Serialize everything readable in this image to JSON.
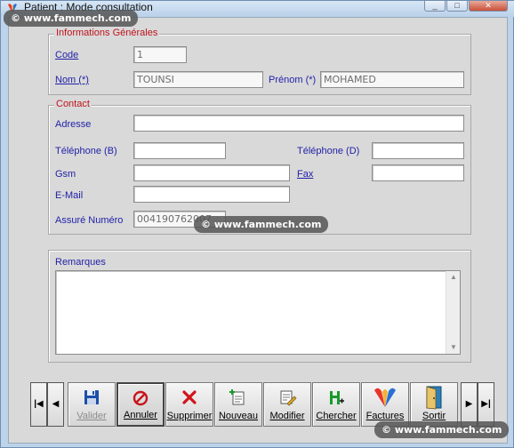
{
  "window": {
    "title": "Patient  : Mode consultation",
    "controls": [
      "_",
      "□",
      "✕"
    ]
  },
  "general": {
    "legend": "Informations Générales",
    "code_label": "Code",
    "code_value": "1",
    "nom_label": "Nom (*)",
    "nom_value": "TOUNSI",
    "prenom_label": "Prénom (*)",
    "prenom_value": "MOHAMED"
  },
  "contact": {
    "legend": "Contact",
    "adresse_label": "Adresse",
    "adresse_value": "",
    "tel_b_label": "Téléphone (B)",
    "tel_b_value": "",
    "tel_d_label": "Téléphone (D)",
    "tel_d_value": "",
    "gsm_label": "Gsm",
    "gsm_value": "",
    "fax_label": "Fax",
    "fax_value": "",
    "email_label": "E-Mail",
    "email_value": "",
    "assure_label": "Assuré Numéro",
    "assure_value": "004190762007"
  },
  "remarques": {
    "label": "Remarques",
    "value": ""
  },
  "toolbar": {
    "first": "|◀",
    "prev": "◀",
    "next": "▶",
    "last": "▶|",
    "buttons": [
      {
        "label": "Valider",
        "icon": "floppy-disk-icon",
        "state": "disabled"
      },
      {
        "label": "Annuler",
        "icon": "cancel-circle-icon",
        "state": "pressed"
      },
      {
        "label": "Supprimer",
        "icon": "red-x-icon",
        "state": "normal"
      },
      {
        "label": "Nouveau",
        "icon": "new-document-icon",
        "state": "normal"
      },
      {
        "label": "Modifier",
        "icon": "edit-document-icon",
        "state": "normal"
      },
      {
        "label": "Chercher",
        "icon": "search-plus-icon",
        "state": "normal"
      },
      {
        "label": "Factures",
        "icon": "invoices-logo-icon",
        "state": "normal"
      },
      {
        "label": "Sortir",
        "icon": "exit-door-icon",
        "state": "normal"
      }
    ]
  },
  "watermark": {
    "text": "© www.fammech.com"
  },
  "colors": {
    "label_blue": "#1f1fa8",
    "legend_red": "#c0141c",
    "client_gray": "#d9d9d9"
  }
}
